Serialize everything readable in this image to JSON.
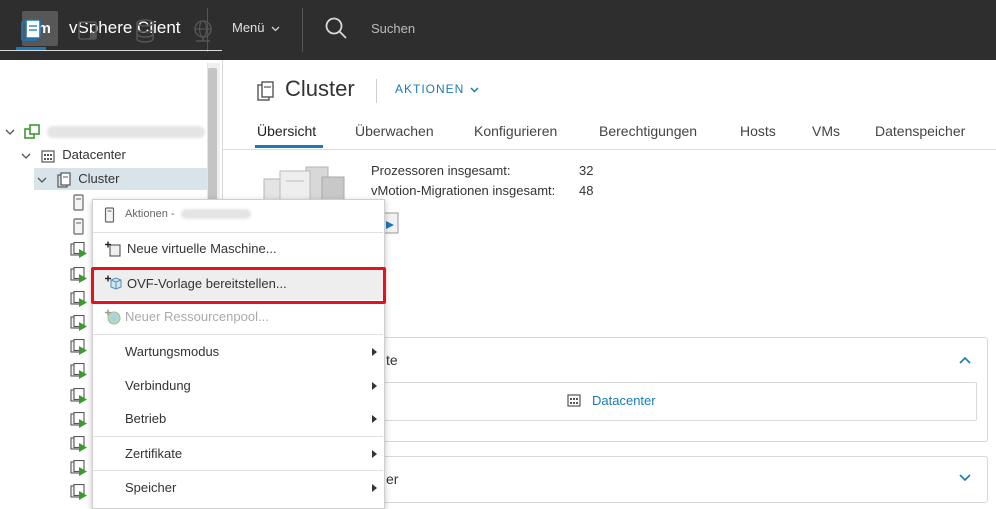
{
  "header": {
    "logo": "vm",
    "app_title": "vSphere Client",
    "menu_label": "Menü",
    "search_placeholder": "Suchen"
  },
  "sidebar": {
    "tabs": [
      "hosts-clusters-icon",
      "vms-templates-icon",
      "storage-icon",
      "network-icon"
    ],
    "tree": {
      "datacenter_label": "Datacenter",
      "cluster_label": "Cluster"
    }
  },
  "main": {
    "title": "Cluster",
    "actions_label": "AKTIONEN",
    "tabs": [
      {
        "label": "Übersicht",
        "active": true
      },
      {
        "label": "Überwachen"
      },
      {
        "label": "Konfigurieren"
      },
      {
        "label": "Berechtigungen"
      },
      {
        "label": "Hosts"
      },
      {
        "label": "VMs"
      },
      {
        "label": "Datenspeicher"
      }
    ],
    "stats": [
      {
        "label": "Prozessoren insgesamt:",
        "value": "32"
      },
      {
        "label": "vMotion-Migrationen insgesamt:",
        "value": "48"
      }
    ],
    "card1_partial_title": "te",
    "card1_link": "Datacenter",
    "card2_partial_title": "er"
  },
  "context_menu": {
    "header": "Aktionen -",
    "items": [
      {
        "label": "Neue virtuelle Maschine...",
        "enabled": true
      },
      {
        "label": "OVF-Vorlage bereitstellen...",
        "enabled": true,
        "highlighted": true
      },
      {
        "label": "Neuer Ressourcenpool...",
        "enabled": false
      },
      {
        "label": "Wartungsmodus",
        "submenu": true
      },
      {
        "label": "Verbindung",
        "submenu": true
      },
      {
        "label": "Betrieb",
        "submenu": true
      },
      {
        "label": "Zertifikate",
        "submenu": true
      },
      {
        "label": "Speicher",
        "submenu": true
      }
    ]
  },
  "colors": {
    "header_bg": "#2e2e2e",
    "accent": "#1a7ab8",
    "selected_row": "#d9e4ea",
    "highlight_border": "#e0141e",
    "vm_green": "#3c9a2f"
  }
}
